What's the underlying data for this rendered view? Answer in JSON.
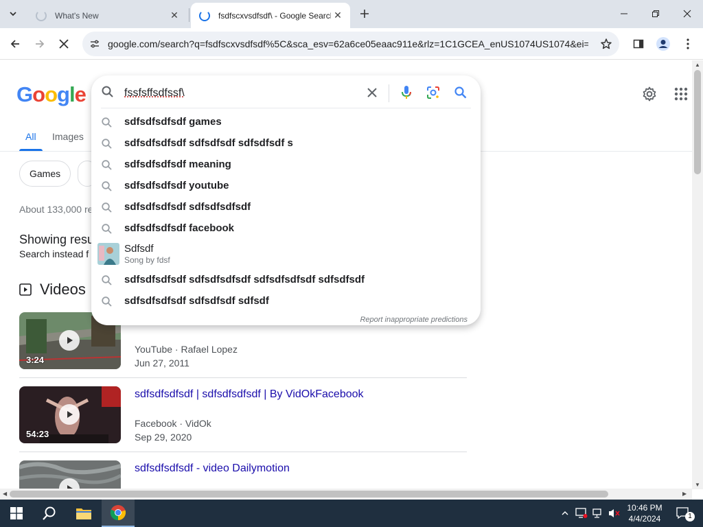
{
  "browser": {
    "tabs": [
      {
        "title": "What's New"
      },
      {
        "title": "fsdfscxvsdfsdf\\ - Google Search"
      }
    ],
    "url": "google.com/search?q=fsdfscxvsdfsdf%5C&sca_esv=62a6ce05eaac911e&rlz=1C1GCEA_enUS1074US1074&ei=G..."
  },
  "google": {
    "logo_letters": [
      "G",
      "o",
      "o",
      "g",
      "l",
      "e"
    ],
    "tabs": [
      "All",
      "Images"
    ],
    "chips": [
      "Games"
    ],
    "stats": "About 133,000 re",
    "showing": "Showing resu",
    "instead": "Search instead f",
    "videos_heading": "Videos"
  },
  "search": {
    "query": "fssfsffsdfssf\\",
    "suggestions": [
      "sdfsdfsdfsdf games",
      "sdfsdfsdfsdf sdfsdfsdf sdfsdfsdf s",
      "sdfsdfsdfsdf meaning",
      "sdfsdfsdfsdf youtube",
      "sdfsdfsdfsdf sdfsdfsdfsdf",
      "sdfsdfsdfsdf facebook"
    ],
    "song": {
      "title": "Sdfsdf",
      "subtitle": "Song by fdsf"
    },
    "suggestions_after": [
      "sdfsdfsdfsdf sdfsdfsdfsdf sdfsdfsdfsdf sdfsdfsdf",
      "sdfsdfsdfsdf sdfsdfsdf sdfsdf"
    ],
    "report": "Report inappropriate predictions"
  },
  "videos": [
    {
      "title": "",
      "source": "YouTube · Rafael Lopez",
      "date": "Jun 27, 2011",
      "duration": "3:24"
    },
    {
      "title": "sdfsdfsdfsdf | sdfsdfsdfsdf | By VidOkFacebook",
      "source": "Facebook · VidOk",
      "date": "Sep 29, 2020",
      "duration": "54:23"
    },
    {
      "title": "sdfsdfsdfsdf - video Dailymotion",
      "source": "",
      "date": "",
      "duration": ""
    }
  ],
  "taskbar": {
    "time": "10:46 PM",
    "date": "4/4/2024",
    "notification_count": "1"
  },
  "colors": {
    "link": "#1a0dab",
    "accent_blue": "#1a73e8",
    "tabstrip_bg": "#dee3ea",
    "taskbar_bg": "#1f2f3f"
  }
}
